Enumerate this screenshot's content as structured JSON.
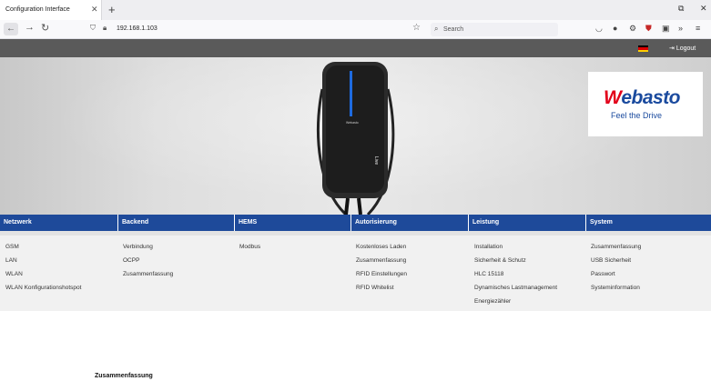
{
  "browser": {
    "tab_title": "Configuration Interface",
    "tab_close": "✕",
    "new_tab": "+",
    "url": "192.168.1.103",
    "search_placeholder": "Search"
  },
  "header": {
    "logout_label": "Logout",
    "language_flag": "german-flag"
  },
  "brand": {
    "logo_text_a": "W",
    "logo_text_b": "ebasto",
    "tagline": "Feel the Drive",
    "device_label": "Live"
  },
  "menu": {
    "columns": [
      {
        "heading": "Netzwerk",
        "items": [
          "GSM",
          "LAN",
          "WLAN",
          "WLAN Konfigurationshotspot"
        ]
      },
      {
        "heading": "Backend",
        "items": [
          "Verbindung",
          "OCPP",
          "Zusammenfassung"
        ]
      },
      {
        "heading": "HEMS",
        "items": [
          "Modbus"
        ]
      },
      {
        "heading": "Autorisierung",
        "items": [
          "Kostenloses Laden",
          "Zusammenfassung",
          "RFID Einstellungen",
          "RFID Whitelist"
        ]
      },
      {
        "heading": "Leistung",
        "items": [
          "Installation",
          "Sicherheit & Schutz",
          "HLC 15118",
          "Dynamisches Lastmanagement",
          "Energiezähler"
        ]
      },
      {
        "heading": "System",
        "items": [
          "Zusammenfassung",
          "USB Sicherheit",
          "Passwort",
          "Systeminformation"
        ]
      }
    ]
  },
  "page": {
    "section_title": "Zusammenfassung"
  },
  "colors": {
    "menu_blue": "#1e4a9a",
    "brand_blue": "#1a4a9e",
    "brand_red": "#e2001a"
  }
}
